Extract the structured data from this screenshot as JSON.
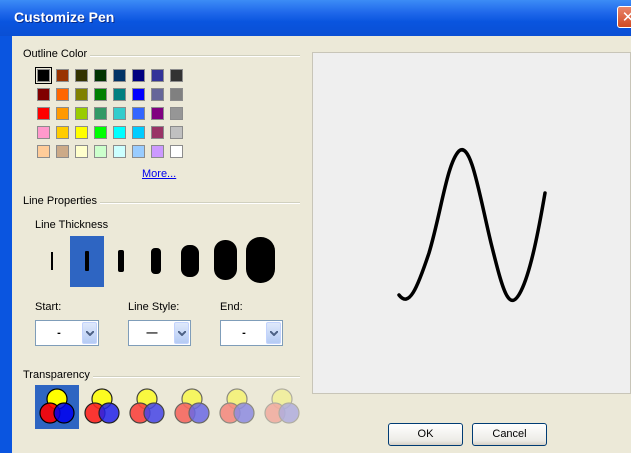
{
  "window": {
    "title": "Customize Pen",
    "close_glyph": "✕"
  },
  "outline_color": {
    "label": "Outline Color",
    "selected": "#000000",
    "more_label": "More...",
    "rows": [
      [
        "#000000",
        "#993300",
        "#333300",
        "#003300",
        "#003366",
        "#000080",
        "#333399",
        "#333333"
      ],
      [
        "#800000",
        "#ff6600",
        "#808000",
        "#008000",
        "#008080",
        "#0000ff",
        "#666699",
        "#808080"
      ],
      [
        "#ff0000",
        "#ff9900",
        "#99cc00",
        "#339966",
        "#33cccc",
        "#3366ff",
        "#800080",
        "#969696"
      ],
      [
        "#ff99cc",
        "#ffcc00",
        "#ffff00",
        "#00ff00",
        "#00ffff",
        "#00ccff",
        "#993366",
        "#c0c0c0"
      ],
      [
        "#ffcc99",
        "#ccaa88",
        "#ffffcc",
        "#ccffcc",
        "#ccffff",
        "#99ccff",
        "#cc99ff",
        "#ffffff"
      ]
    ]
  },
  "line_properties": {
    "label": "Line Properties",
    "thickness_label": "Line Thickness",
    "thickness_count": 7,
    "selected_thickness_index": 1,
    "start_label": "Start:",
    "start_value": "-",
    "style_label": "Line Style:",
    "style_value": "—",
    "end_label": "End:",
    "end_value": "-"
  },
  "transparency": {
    "label": "Transparency",
    "levels": [
      1.0,
      0.85,
      0.7,
      0.55,
      0.4,
      0.25
    ],
    "selected_index": 0
  },
  "buttons": {
    "ok": "OK",
    "cancel": "Cancel"
  },
  "colors": {
    "titlebar": "#0a55df",
    "face": "#ece9d8",
    "selection": "#2e65c2"
  }
}
